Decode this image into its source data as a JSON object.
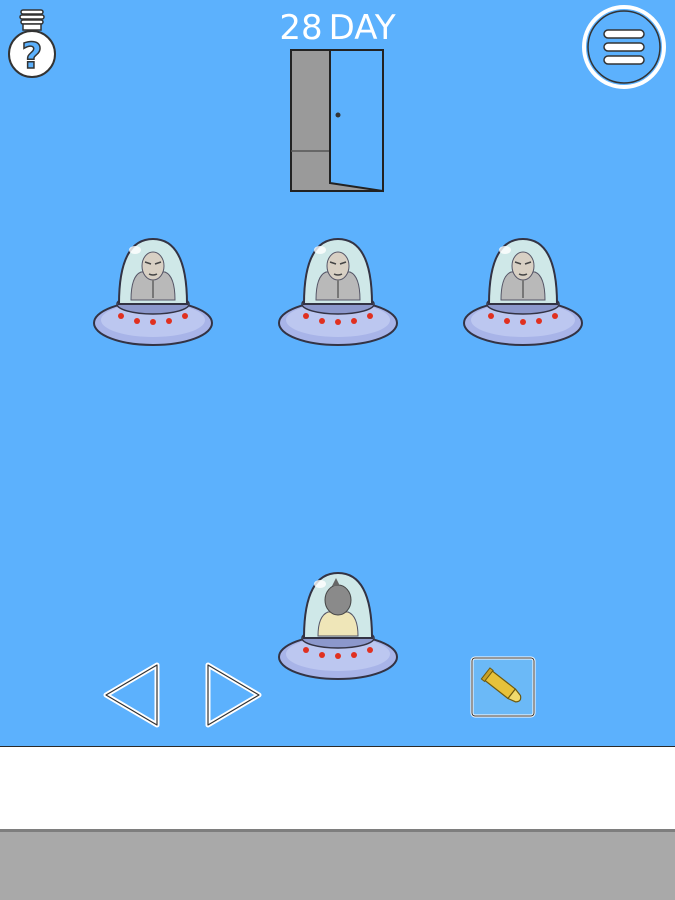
{
  "hud": {
    "day_number": "28",
    "day_label": "DAY",
    "hint_icon": "lightbulb-question-icon",
    "menu_icon": "hamburger-menu-icon"
  },
  "scene": {
    "door": "open-door",
    "enemy_ufos": [
      "ufo-with-old-man",
      "ufo-with-old-man",
      "ufo-with-old-man"
    ],
    "player_ufo": "ufo-with-player"
  },
  "controls": {
    "left_icon": "arrow-left-icon",
    "right_icon": "arrow-right-icon"
  },
  "inventory": {
    "item": "bullet-icon"
  },
  "colors": {
    "sky": "#5cb1fd",
    "ufo_body": "#a8b4e8",
    "ufo_lights": "#e03020",
    "item_slot": "#6bb9f7",
    "bottom_bar": "#a9a9a9"
  }
}
